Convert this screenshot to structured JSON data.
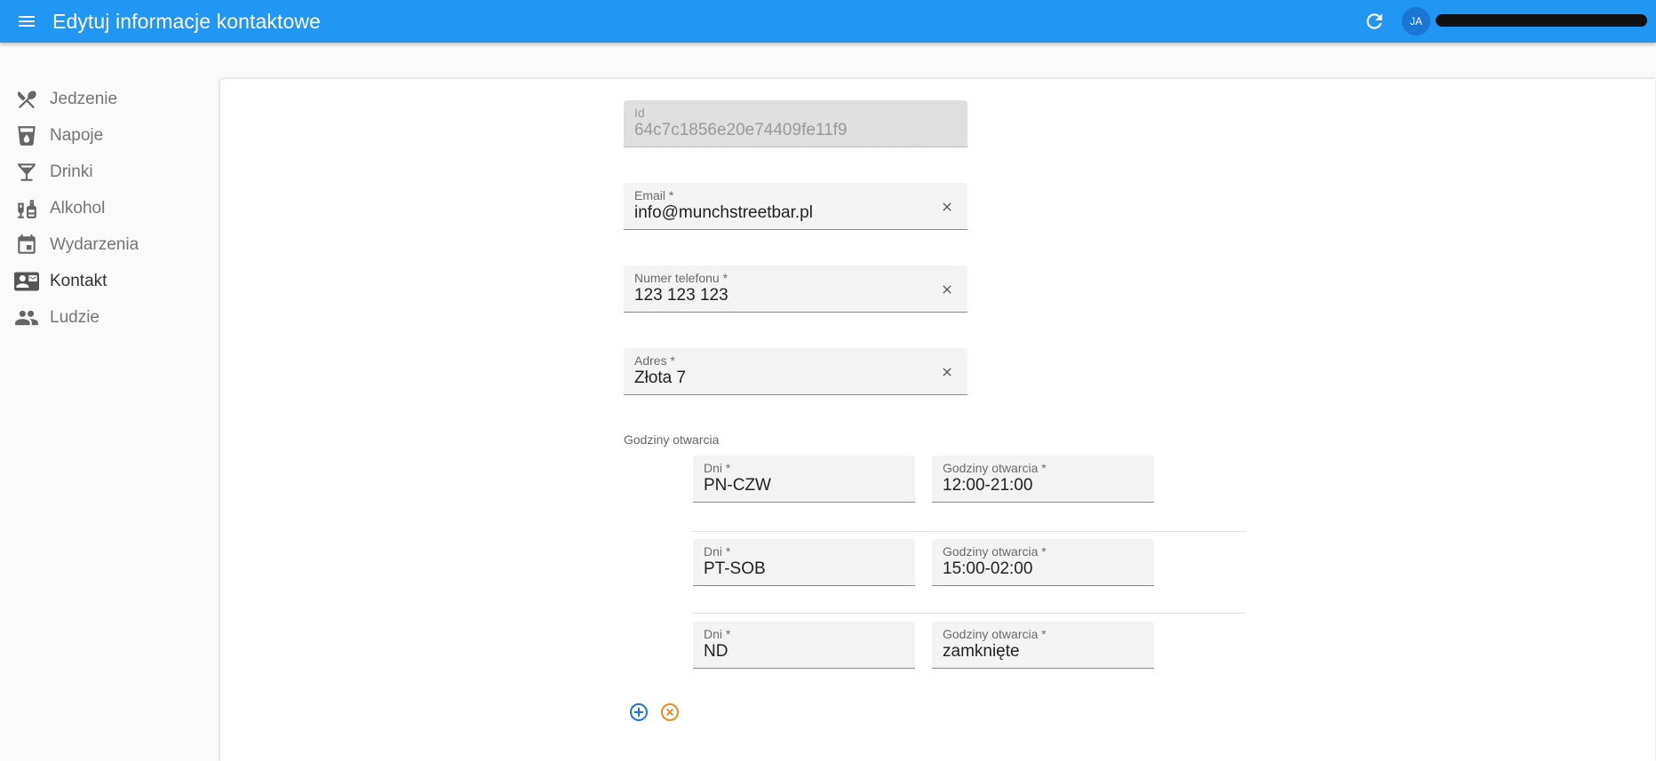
{
  "app": {
    "title": "Edytuj informacje kontaktowe",
    "brand_color": "#2196f3",
    "user_initials": "JA"
  },
  "sidebar": {
    "items": [
      {
        "label": "Jedzenie",
        "icon": "restaurant-icon",
        "active": false
      },
      {
        "label": "Napoje",
        "icon": "local-drink-icon",
        "active": false
      },
      {
        "label": "Drinki",
        "icon": "local-bar-icon",
        "active": false
      },
      {
        "label": "Alkohol",
        "icon": "liquor-icon",
        "active": false
      },
      {
        "label": "Wydarzenia",
        "icon": "event-icon",
        "active": false
      },
      {
        "label": "Kontakt",
        "icon": "contact-mail-icon",
        "active": true
      },
      {
        "label": "Ludzie",
        "icon": "people-icon",
        "active": false
      }
    ]
  },
  "form": {
    "id": {
      "label": "Id",
      "value": "64c7c1856e20e74409fe11f9"
    },
    "email": {
      "label": "Email *",
      "value": "info@munchstreetbar.pl"
    },
    "phone": {
      "label": "Numer telefonu *",
      "value": "123 123 123"
    },
    "address": {
      "label": "Adres *",
      "value": "Złota 7"
    },
    "hours_section_label": "Godziny otwarcia",
    "hours": [
      {
        "days_label": "Dni *",
        "days": "PN-CZW",
        "hours_label": "Godziny otwarcia *",
        "hours": "12:00-21:00"
      },
      {
        "days_label": "Dni *",
        "days": "PT-SOB",
        "hours_label": "Godziny otwarcia *",
        "hours": "15:00-02:00"
      },
      {
        "days_label": "Dni *",
        "days": "ND",
        "hours_label": "Godziny otwarcia *",
        "hours": "zamknięte"
      }
    ]
  },
  "colors": {
    "add_button": "#1976d2",
    "remove_button": "#ef8b1e"
  }
}
